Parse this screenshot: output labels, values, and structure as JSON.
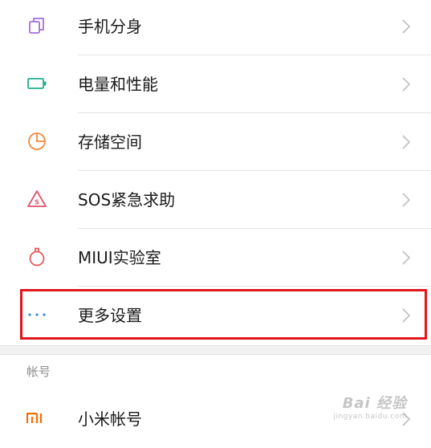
{
  "settings_items": [
    {
      "label": "手机分身",
      "icon": "dual-apps-icon",
      "color": "#a56ddb"
    },
    {
      "label": "电量和性能",
      "icon": "battery-icon",
      "color": "#1fae8c"
    },
    {
      "label": "存储空间",
      "icon": "storage-pie-icon",
      "color": "#f08a3c"
    },
    {
      "label": "SOS紧急求助",
      "icon": "sos-warning-icon",
      "color": "#e2506a"
    },
    {
      "label": "MIUI实验室",
      "icon": "lab-flask-icon",
      "color": "#ea5a5a"
    },
    {
      "label": "更多设置",
      "icon": "more-dots-icon",
      "color": "#2e8de0"
    }
  ],
  "account_section": {
    "title": "帐号",
    "item": {
      "label": "小米帐号",
      "icon": "mi-logo-icon",
      "color": "#ff6900"
    }
  },
  "highlight_color": "#e1161c",
  "watermark": {
    "main": "Bai 经验",
    "sub": "jingyan.baidu.com"
  }
}
